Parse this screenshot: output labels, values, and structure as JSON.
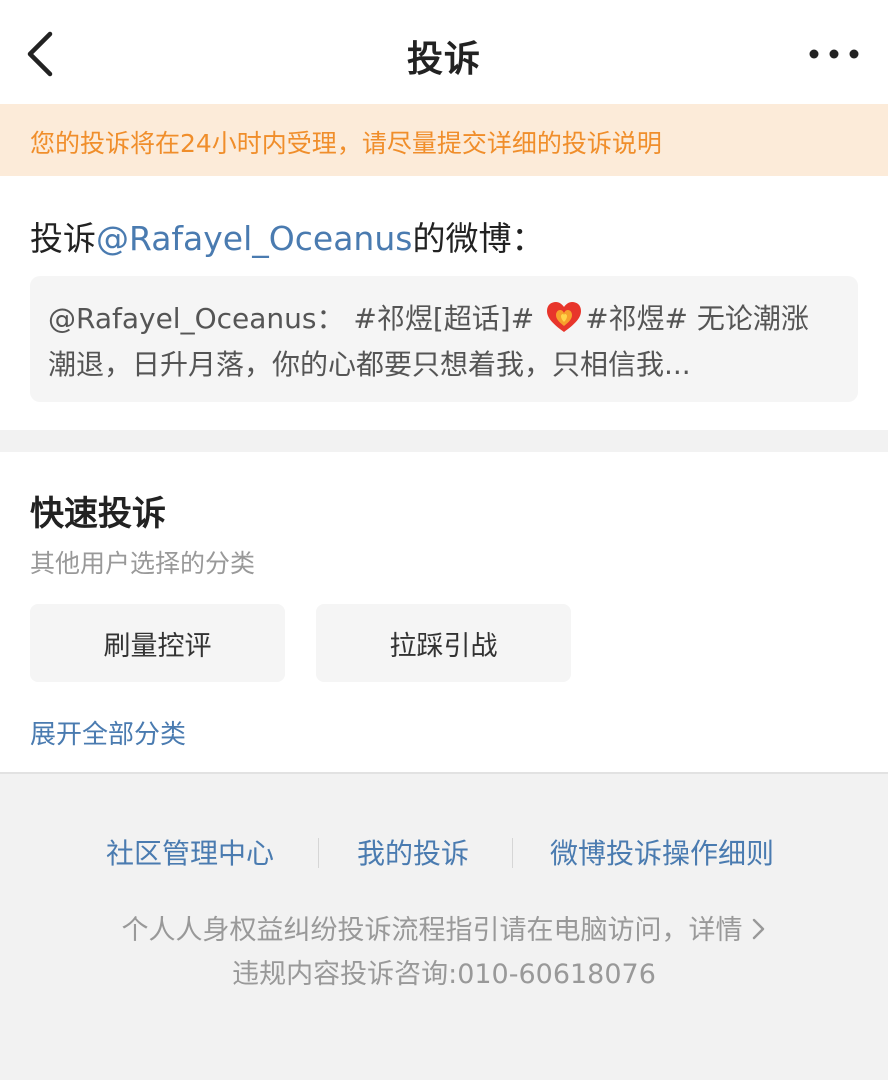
{
  "header": {
    "title": "投诉",
    "back_icon": "chevron-left-icon",
    "more_icon": "more-horizontal-icon"
  },
  "notice": {
    "text": "您的投诉将在24小时内受理，请尽量提交详细的投诉说明",
    "color": "#f08e2b",
    "background": "#fcebd9"
  },
  "target": {
    "prefix": "投诉",
    "username": "@Rafayel_Oceanus",
    "suffix": "的微博：",
    "quote": {
      "part1": "@Rafayel_Oceanus： #祁煜[超话]# ",
      "emoji": "heart-on-fire-icon",
      "part2": "#祁煜# 无论潮涨潮退，日升月落，你的心都要只想着我，只相信我..."
    }
  },
  "quick": {
    "title": "快速投诉",
    "subtitle": "其他用户选择的分类",
    "options": [
      {
        "label": "刷量控评"
      },
      {
        "label": "拉踩引战"
      }
    ],
    "expand_label": "展开全部分类"
  },
  "footer": {
    "links": [
      {
        "label": "社区管理中心"
      },
      {
        "label": "我的投诉"
      },
      {
        "label": "微博投诉操作细则"
      }
    ],
    "note_line1": "个人人身权益纠纷投诉流程指引请在电脑访问，详情",
    "note_line2": "违规内容投诉咨询:010-60618076"
  },
  "colors": {
    "link_blue": "#4a7bb0",
    "page_bg": "#f2f2f2"
  }
}
